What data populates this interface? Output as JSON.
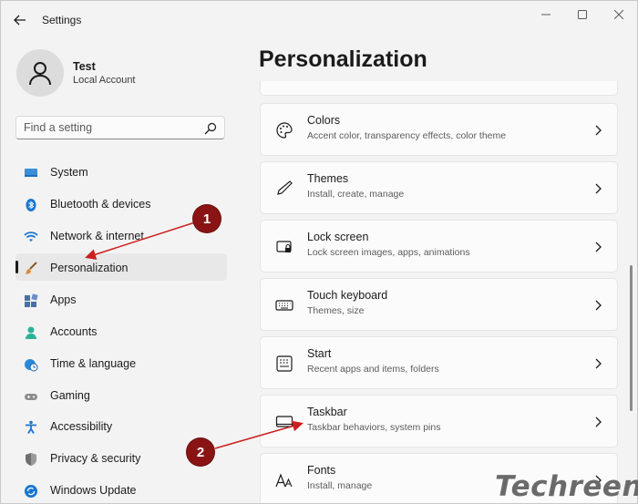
{
  "app": {
    "title": "Settings"
  },
  "user": {
    "name": "Test",
    "account_type": "Local Account"
  },
  "search": {
    "placeholder": "Find a setting"
  },
  "sidebar": {
    "items": [
      {
        "label": "System",
        "icon": "monitor-icon"
      },
      {
        "label": "Bluetooth & devices",
        "icon": "bluetooth-icon"
      },
      {
        "label": "Network & internet",
        "icon": "wifi-icon"
      },
      {
        "label": "Personalization",
        "icon": "brush-icon",
        "selected": true
      },
      {
        "label": "Apps",
        "icon": "apps-icon"
      },
      {
        "label": "Accounts",
        "icon": "person-icon"
      },
      {
        "label": "Time & language",
        "icon": "globe-clock-icon"
      },
      {
        "label": "Gaming",
        "icon": "gamepad-icon"
      },
      {
        "label": "Accessibility",
        "icon": "accessibility-icon"
      },
      {
        "label": "Privacy & security",
        "icon": "shield-icon"
      },
      {
        "label": "Windows Update",
        "icon": "update-icon"
      }
    ]
  },
  "main": {
    "title": "Personalization",
    "cards": [
      {
        "title": "Colors",
        "subtitle": "Accent color, transparency effects, color theme",
        "icon": "palette-icon"
      },
      {
        "title": "Themes",
        "subtitle": "Install, create, manage",
        "icon": "pen-icon"
      },
      {
        "title": "Lock screen",
        "subtitle": "Lock screen images, apps, animations",
        "icon": "lock-screen-icon"
      },
      {
        "title": "Touch keyboard",
        "subtitle": "Themes, size",
        "icon": "keyboard-icon"
      },
      {
        "title": "Start",
        "subtitle": "Recent apps and items, folders",
        "icon": "start-icon"
      },
      {
        "title": "Taskbar",
        "subtitle": "Taskbar behaviors, system pins",
        "icon": "taskbar-icon"
      },
      {
        "title": "Fonts",
        "subtitle": "Install, manage",
        "icon": "fonts-icon"
      }
    ]
  },
  "annotations": {
    "marker_1": "1",
    "marker_2": "2",
    "color": "#8a1414"
  },
  "watermark": "Techreen",
  "colors": {
    "accent": "#0067c0",
    "selected_bg": "#e8e8e8",
    "annotation": "#cc1f1f"
  }
}
